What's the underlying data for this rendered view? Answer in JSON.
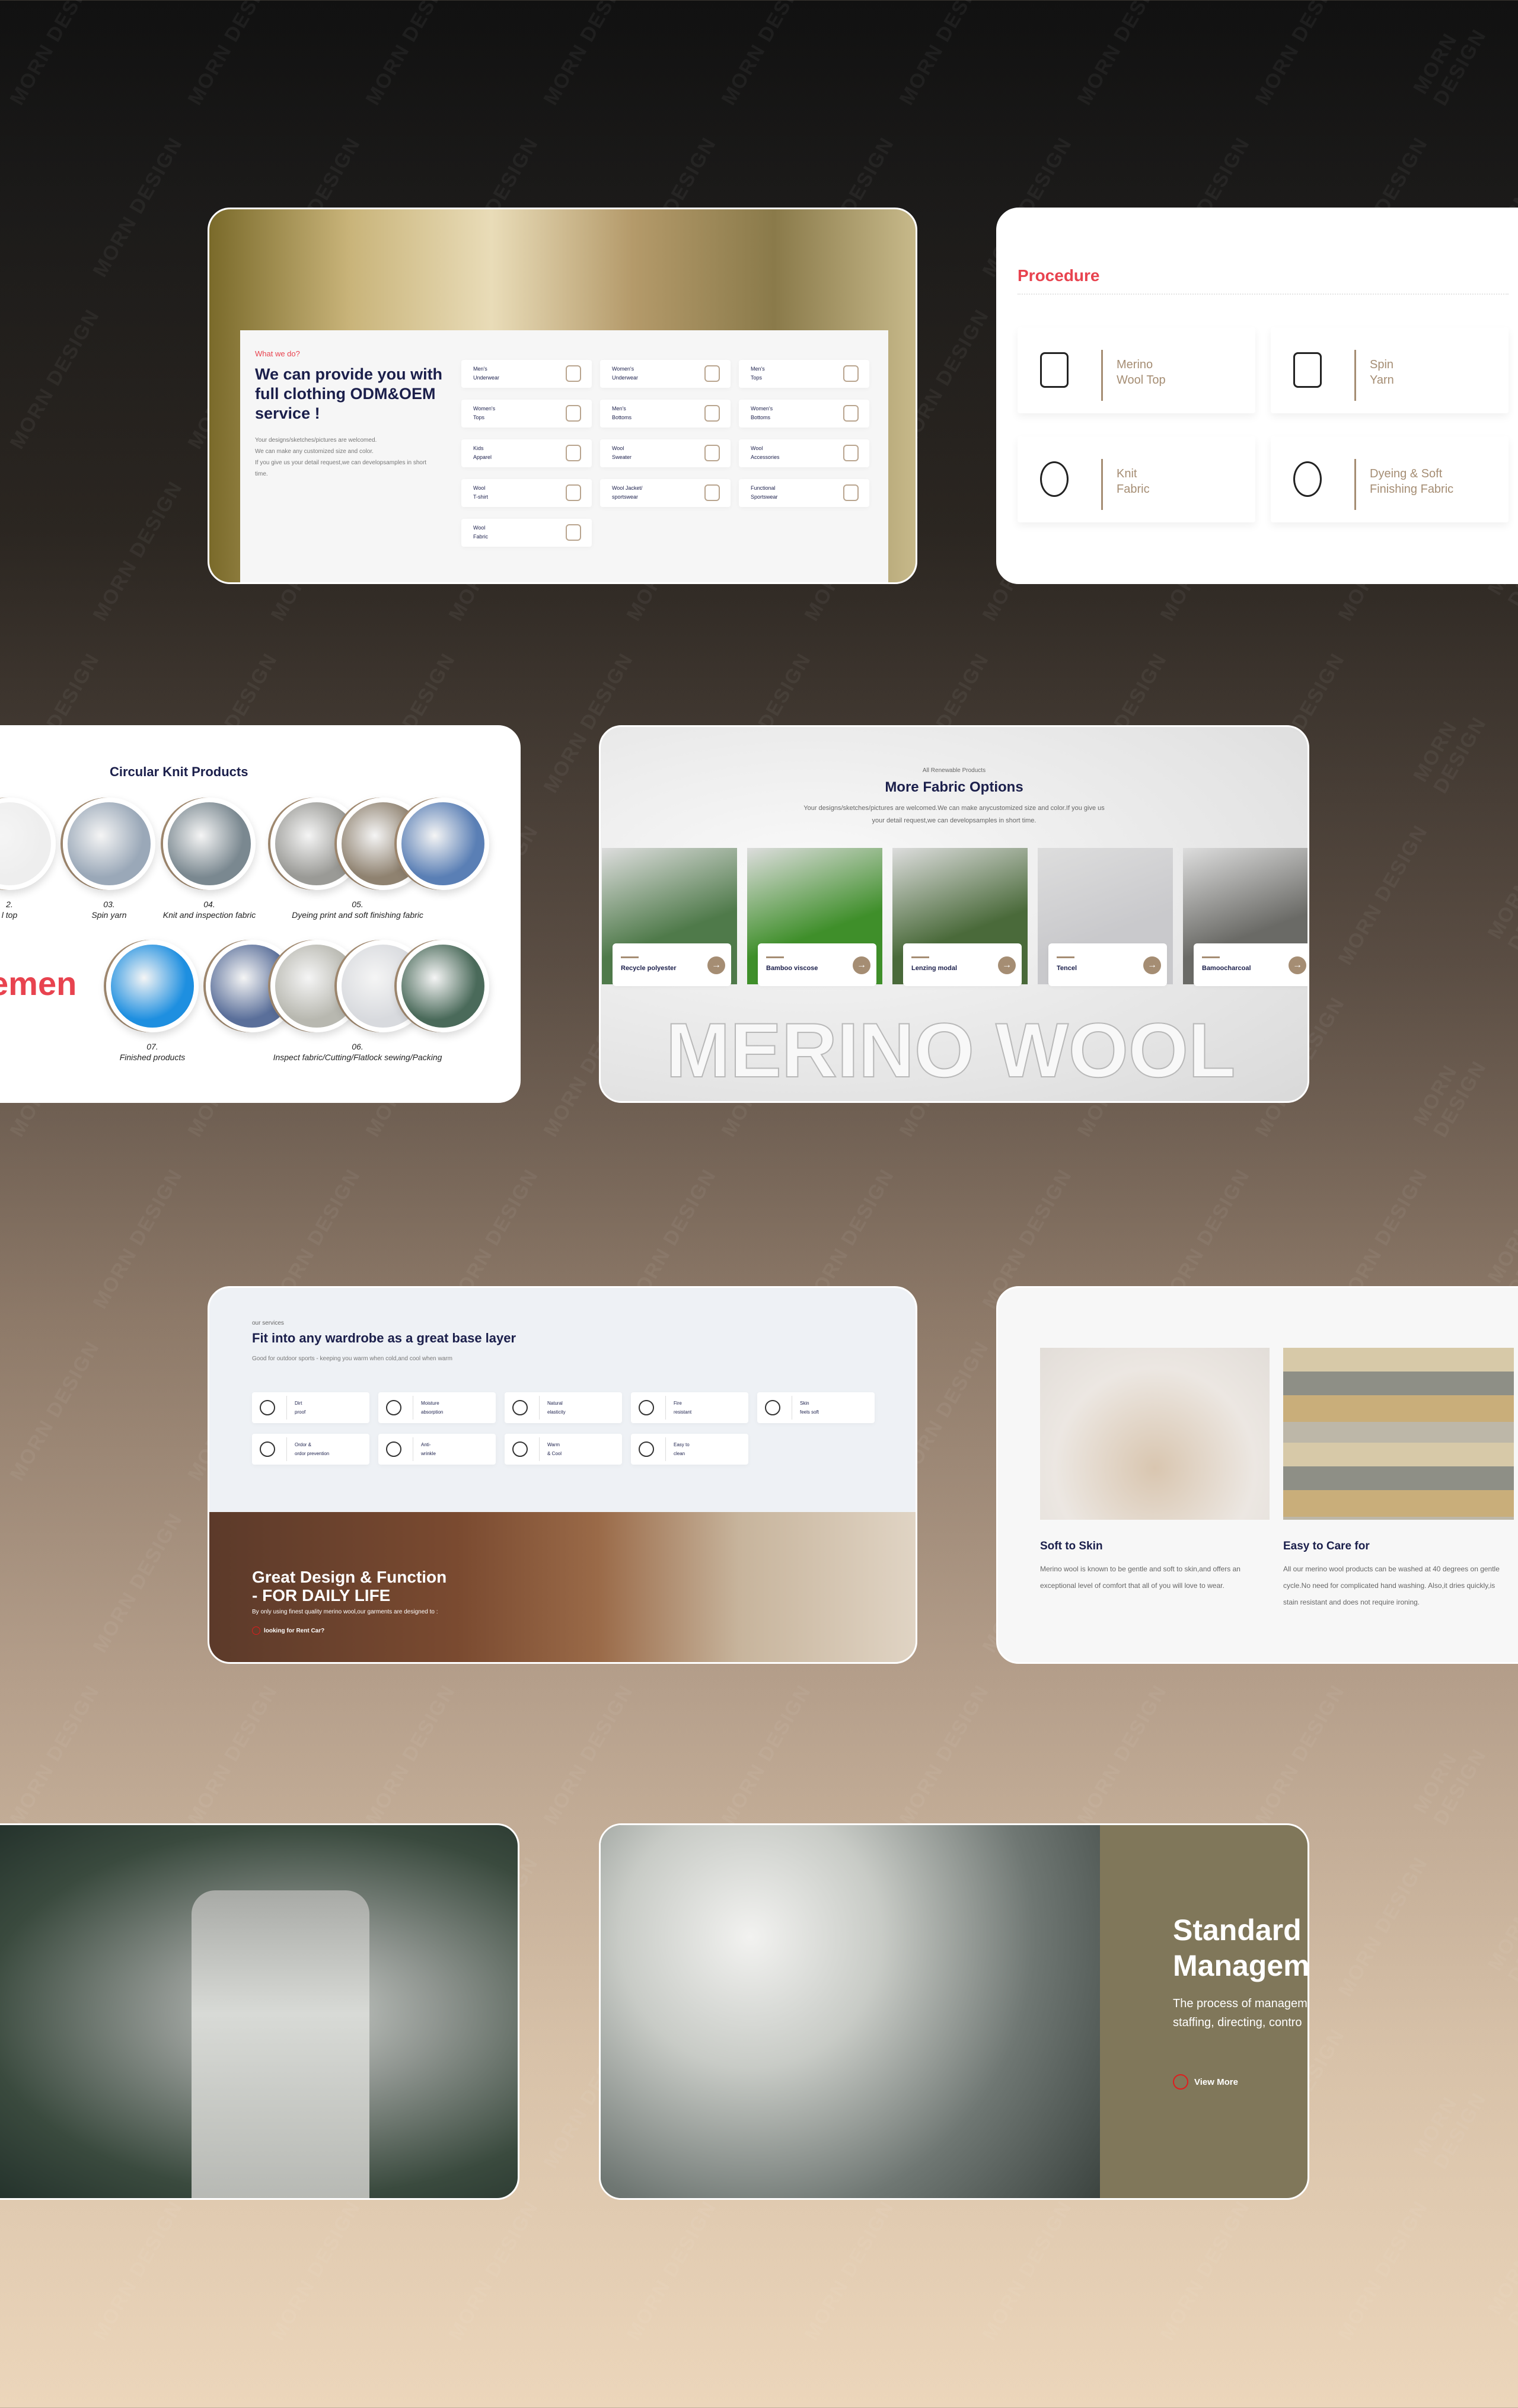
{
  "watermark": "MORN DESIGN",
  "card_what": {
    "eyebrow": "What we do?",
    "title_lines": [
      "We can provide you with",
      "full clothing ODM&OEM",
      "service !"
    ],
    "desc_lines": [
      "Your designs/sketches/pictures are welcomed.",
      "We can make any customized size and color.",
      "If you give us your detail request,we can developsamples in short",
      "time."
    ],
    "items": [
      [
        "Men's",
        "Underwear"
      ],
      [
        "Women's",
        "Underwear"
      ],
      [
        "Men's",
        "Tops"
      ],
      [
        "Women's",
        "Tops"
      ],
      [
        "Men's",
        "Bottoms"
      ],
      [
        "Women's",
        "Bottoms"
      ],
      [
        "Kids",
        "Apparel"
      ],
      [
        "Wool",
        "Sweater"
      ],
      [
        "Wool",
        "Accessories"
      ],
      [
        "Wool",
        "T-shirt"
      ],
      [
        "Wool Jacket/",
        "sportswear"
      ],
      [
        "Functional",
        "Sportswear"
      ],
      [
        "Wool",
        "Fabric"
      ]
    ]
  },
  "card_procedure": {
    "title": "Procedure",
    "steps": [
      [
        "Merino",
        "Wool Top"
      ],
      [
        "Spin",
        "Yarn"
      ],
      [
        "Knit",
        "Fabric"
      ],
      [
        "Dyeing & Soft",
        "Finishing Fabric"
      ]
    ]
  },
  "card_knit": {
    "title": "Circular Knit Products",
    "side_text": "emen",
    "steps": [
      {
        "num": "2.",
        "label": "l top"
      },
      {
        "num": "03.",
        "label": "Spin yarn"
      },
      {
        "num": "04.",
        "label": "Knit and inspection fabric"
      },
      {
        "num": "05.",
        "label": "Dyeing print and soft finishing fabric"
      },
      {
        "num": "07.",
        "label": "Finished products"
      },
      {
        "num": "06.",
        "label": "Inspect fabric/Cutting/Flatlock sewing/Packing"
      }
    ]
  },
  "card_fabric": {
    "eyebrow": "All Renewable Products",
    "title": "More Fabric Options",
    "desc_lines": [
      "Your designs/sketches/pictures are welcomed.We can make anycustomized size and color.If you give us",
      "your detail request,we can developsamples in short time."
    ],
    "items": [
      "Recycle polyester",
      "Bamboo viscose",
      "Lenzing modal",
      "Tencel",
      "Bamoocharcoal"
    ],
    "bg_text": "MERINO WOOL"
  },
  "card_services": {
    "eyebrow": "our services",
    "title": "Fit into any wardrobe as a great base layer",
    "desc": "Good for outdoor sports - keeping you warm when cold,and cool when warm",
    "features": [
      [
        "Dirt",
        "proof"
      ],
      [
        "Moisture",
        "absorption"
      ],
      [
        "Natural",
        "elasticity"
      ],
      [
        "Fire",
        "resistant"
      ],
      [
        "Skin",
        "feels soft"
      ],
      [
        "Ordor &",
        "ordor prevention"
      ],
      [
        "Anti-",
        "wrinkle"
      ],
      [
        "Warm",
        "& Cool"
      ],
      [
        "Easy to",
        "clean"
      ]
    ],
    "banner_title_1": "Great Design & Function",
    "banner_title_2": "- FOR DAILY LIFE",
    "banner_desc": "By only using finest quality merino wool,our garments are designed to :",
    "banner_link": "looking for Rent Car?"
  },
  "card_care": {
    "items": [
      {
        "title": "Soft to Skin",
        "text": "Merino wool is known to be gentle and soft to skin,and offers an exceptional level of comfort that all of you will love to wear."
      },
      {
        "title": "Easy to Care for",
        "text": "All our merino wool products can be washed at 40 degrees on gentle cycle.No need for complicated hand washing. Also,it dries quickly,is stain resistant and does not require ironing."
      }
    ]
  },
  "card_standard": {
    "title_1": "Standard",
    "title_2": "Managem",
    "text_1": "The process of managem",
    "text_2": "staffing, directing, contro",
    "link": "View More"
  },
  "colors": {
    "accent_red": "#e8434f",
    "brown": "#a58d73",
    "navy": "#1b1f4b",
    "olive": "#80775a"
  }
}
